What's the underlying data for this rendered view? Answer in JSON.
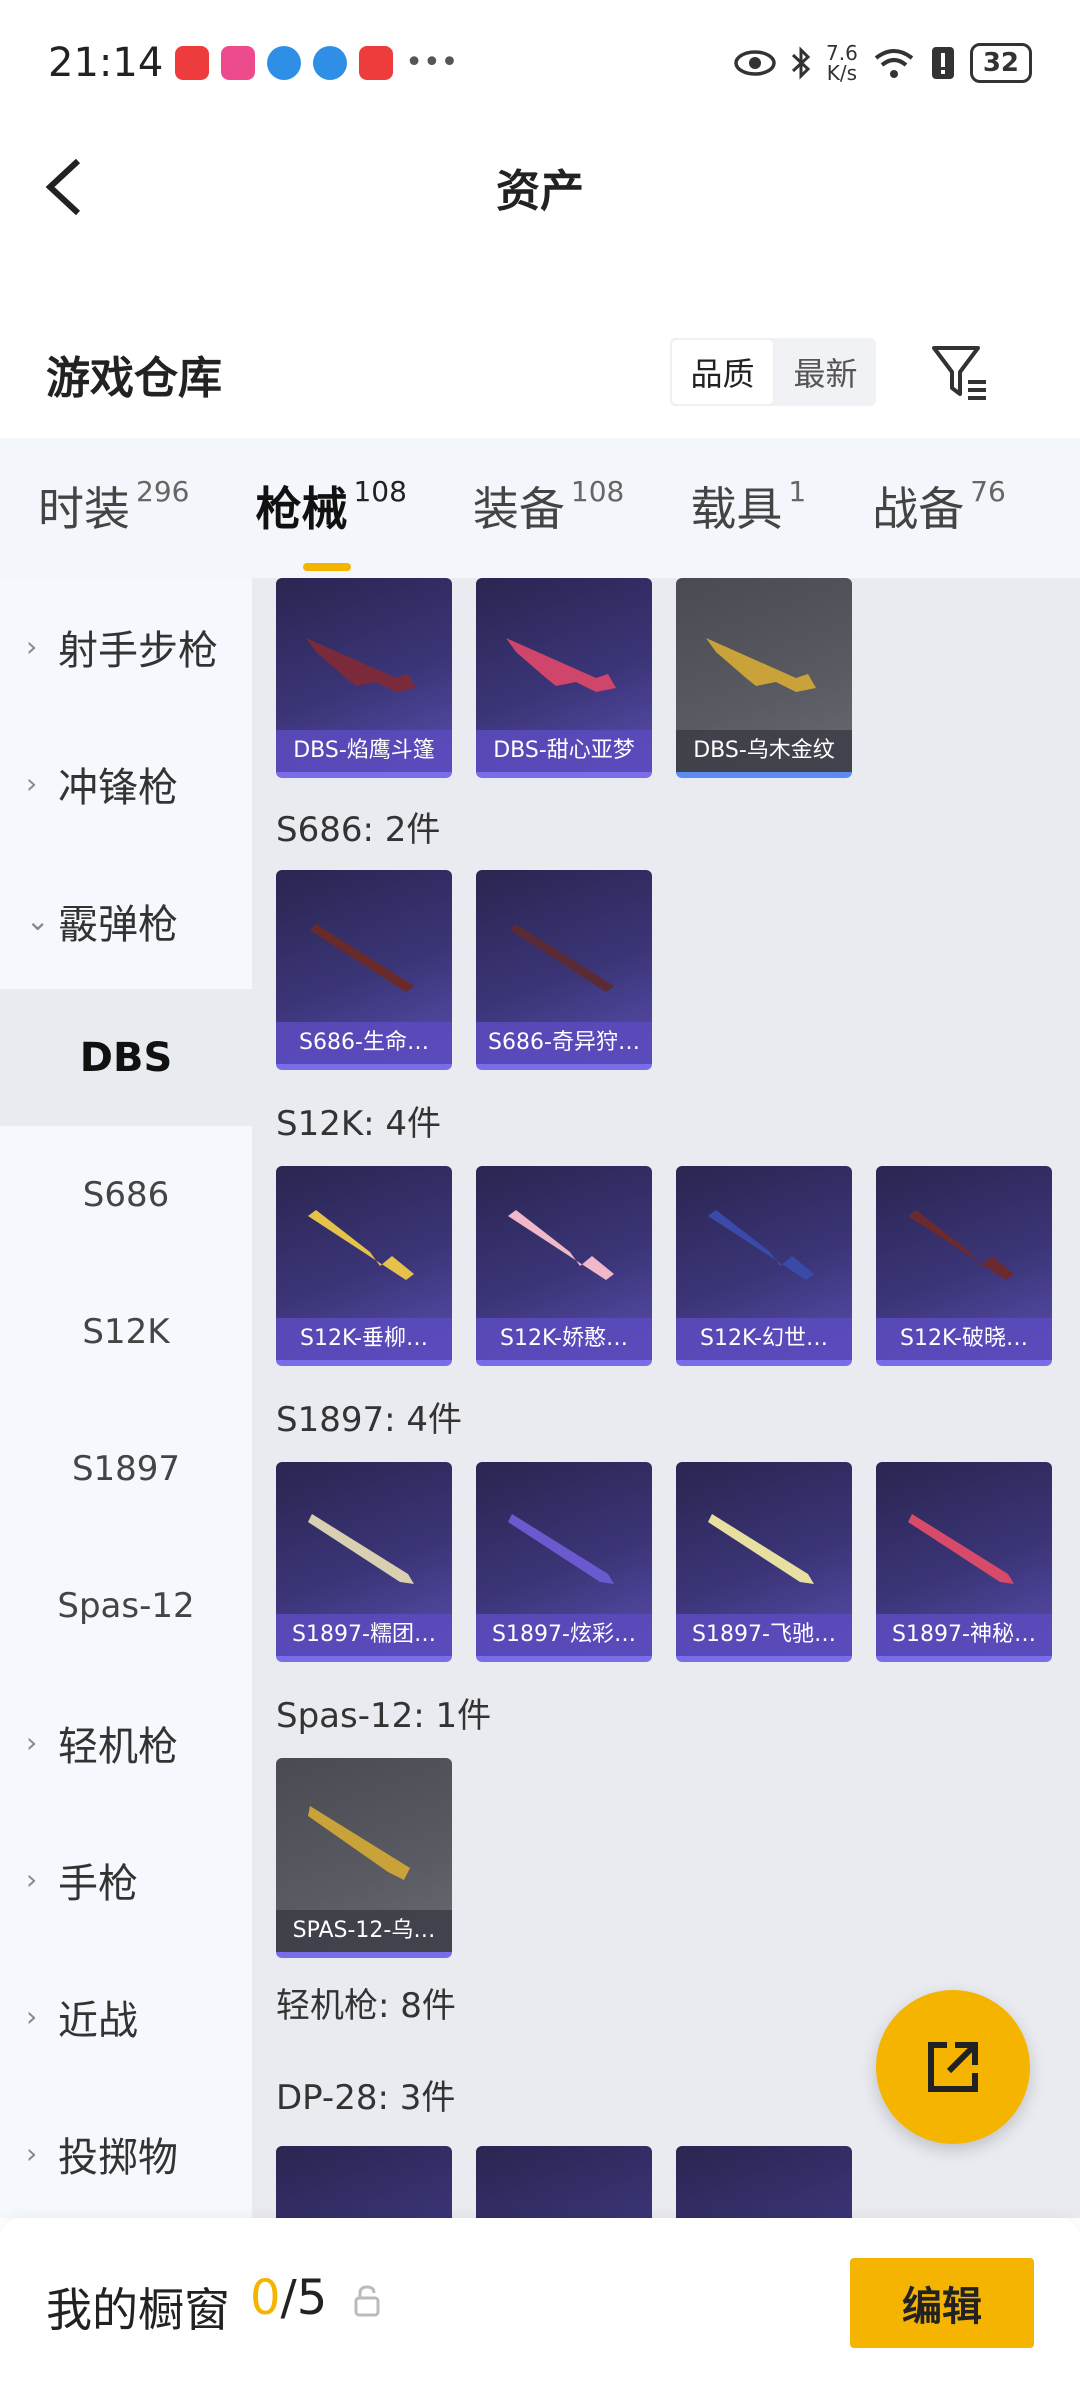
{
  "status_bar": {
    "time": "21:14",
    "net_speed_top": "7.6",
    "net_speed_bottom": "K/s",
    "battery": "32"
  },
  "header": {
    "title": "资产"
  },
  "warehouse": {
    "title": "游戏仓库",
    "sort_options": [
      "品质",
      "最新"
    ],
    "sort_active": "品质"
  },
  "categories": [
    {
      "label": "时装",
      "count": "296"
    },
    {
      "label": "枪械",
      "count": "108",
      "active": true
    },
    {
      "label": "装备",
      "count": "108"
    },
    {
      "label": "载具",
      "count": "1"
    },
    {
      "label": "战备",
      "count": "76"
    }
  ],
  "sidebar": {
    "items": [
      {
        "type": "group",
        "label": "射手步枪",
        "expanded": false
      },
      {
        "type": "group",
        "label": "冲锋枪",
        "expanded": false
      },
      {
        "type": "group",
        "label": "霰弹枪",
        "expanded": true
      },
      {
        "type": "sub",
        "label": "DBS",
        "active": true
      },
      {
        "type": "sub",
        "label": "S686"
      },
      {
        "type": "sub",
        "label": "S12K"
      },
      {
        "type": "sub",
        "label": "S1897"
      },
      {
        "type": "sub",
        "label": "Spas-12"
      },
      {
        "type": "group",
        "label": "轻机枪",
        "expanded": false
      },
      {
        "type": "group",
        "label": "手枪",
        "expanded": false
      },
      {
        "type": "group",
        "label": "近战",
        "expanded": false
      },
      {
        "type": "group",
        "label": "投掷物",
        "expanded": false
      }
    ]
  },
  "content": {
    "dbs_items": [
      "DBS-焰鹰斗篷",
      "DBS-甜心亚梦",
      "DBS-乌木金纹"
    ],
    "s686": {
      "label": "S686: 2件",
      "items": [
        "S686-生命…",
        "S686-奇异狩…"
      ]
    },
    "s12k": {
      "label": "S12K: 4件",
      "items": [
        "S12K-垂柳…",
        "S12K-娇憨…",
        "S12K-幻世…",
        "S12K-破晓…"
      ]
    },
    "s1897": {
      "label": "S1897: 4件",
      "items": [
        "S1897-糯团…",
        "S1897-炫彩…",
        "S1897-飞驰…",
        "S1897-神秘…"
      ]
    },
    "spas12": {
      "label": "Spas-12: 1件",
      "items": [
        "SPAS-12-乌…"
      ]
    },
    "lmg_label": "轻机枪: 8件",
    "dp28_label": "DP-28: 3件"
  },
  "bottom": {
    "showcase_label": "我的橱窗",
    "count_current": "0",
    "count_total": "/5",
    "edit_label": "编辑"
  },
  "colors": {
    "accent": "#f5b400",
    "card_purple": "#3b3578",
    "card_gold": "#5a5a63"
  }
}
